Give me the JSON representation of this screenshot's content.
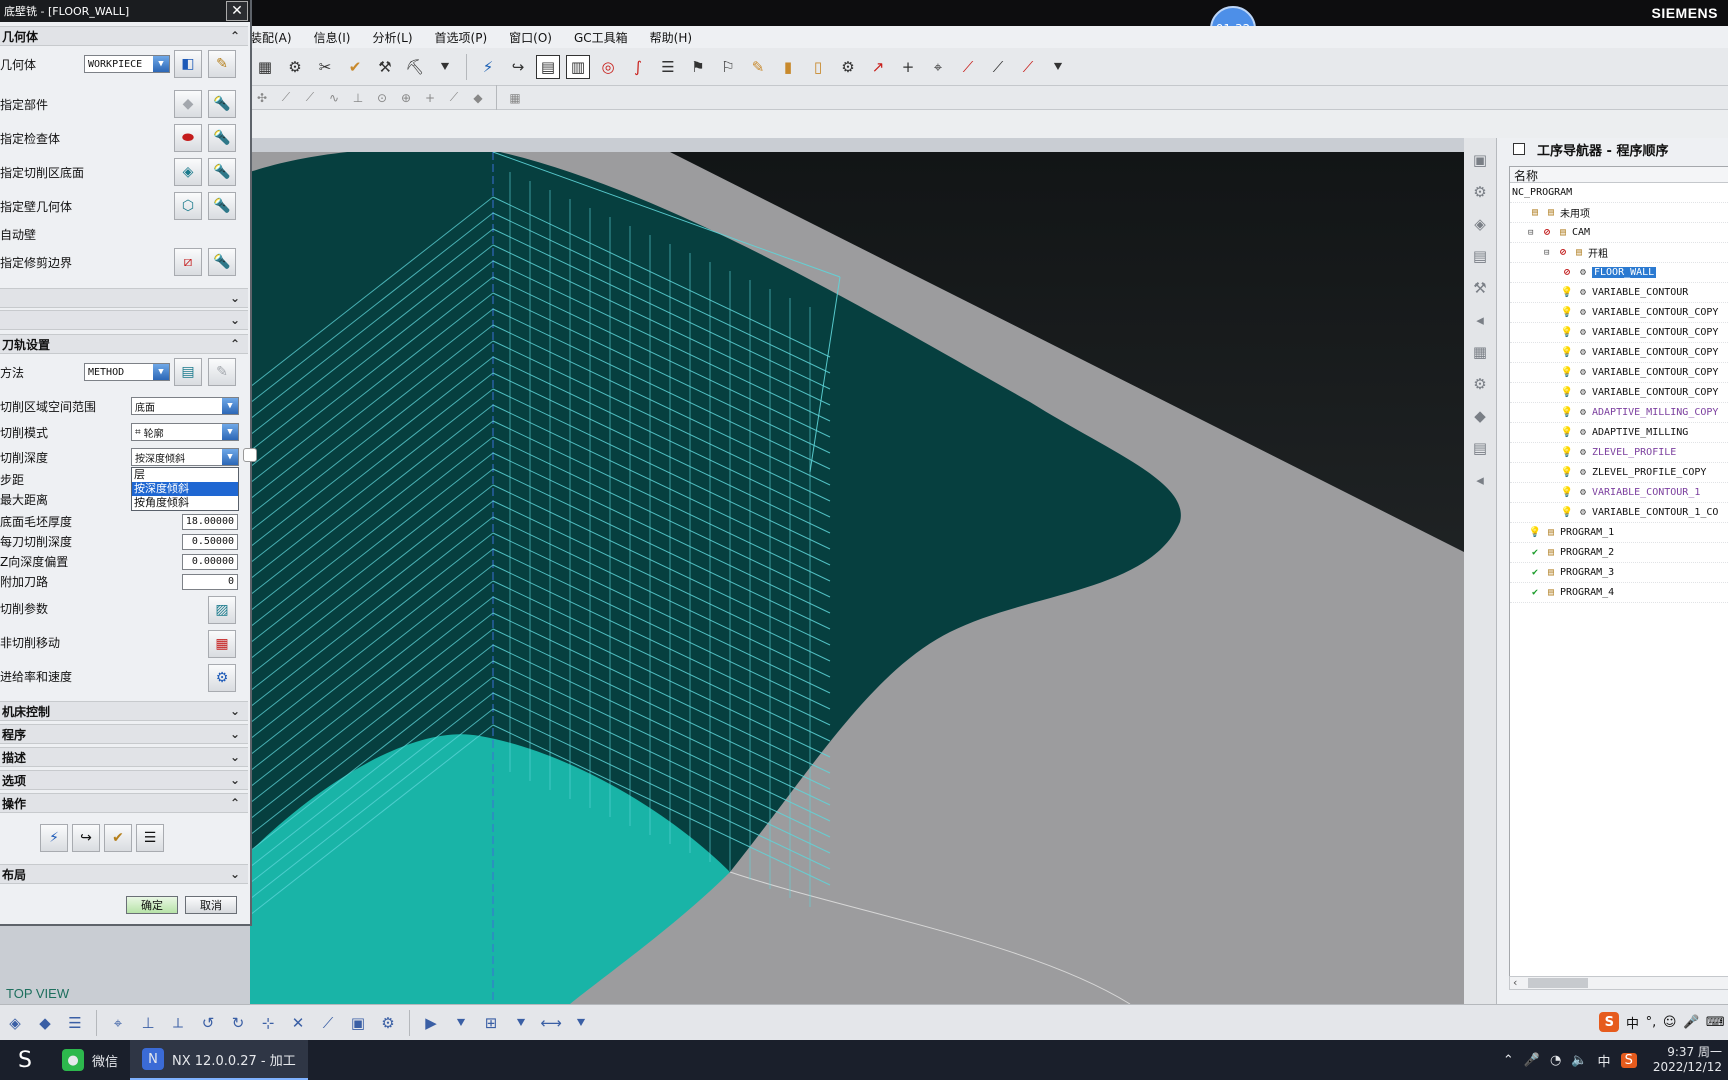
{
  "window": {
    "brand": "SIEMENS",
    "timer": "01:32"
  },
  "menu": [
    "装配(A)",
    "信息(I)",
    "分析(L)",
    "首选项(P)",
    "窗口(O)",
    "GC工具箱",
    "帮助(H)"
  ],
  "dialog": {
    "title": "底壁铣 - [FLOOR_WALL]",
    "close": "✕",
    "geometry_section": "几何体",
    "geometry_rows": [
      {
        "label": "几何体",
        "value": "WORKPIECE"
      },
      {
        "label": "指定部件"
      },
      {
        "label": "指定检查体"
      },
      {
        "label": "指定切削区底面"
      },
      {
        "label": "指定壁几何体"
      },
      {
        "label": "自动壁"
      },
      {
        "label": "指定修剪边界"
      }
    ],
    "collapsed_sections_a": [
      "",
      ""
    ],
    "method_section": "刀轨设置",
    "method_label": "方法",
    "method_value": "METHOD",
    "settings": [
      {
        "label": "切削区域空间范围",
        "value": "底面"
      },
      {
        "label": "切削模式",
        "value": "轮廓"
      },
      {
        "label": "切削深度",
        "value": "按深度倾斜"
      }
    ],
    "dropdown_options": [
      "层",
      "按深度倾斜",
      "按角度倾斜"
    ],
    "hidden_rows": [
      "步距",
      "最大距离"
    ],
    "numeric_fields": [
      {
        "label": "底面毛坯厚度",
        "value": "18.00000"
      },
      {
        "label": "每刀切削深度",
        "value": "0.50000"
      },
      {
        "label": "Z向深度偏置",
        "value": "0.00000"
      },
      {
        "label": "附加刀路",
        "value": "0"
      }
    ],
    "action_rows": [
      "切削参数",
      "非切削移动",
      "进给率和速度"
    ],
    "lower_sections": [
      "机床控制",
      "程序",
      "描述",
      "选项",
      "操作"
    ],
    "last_section": "布局",
    "ok": "确定",
    "cancel": "取消"
  },
  "viewport": {
    "view_label": "TOP VIEW",
    "colors": {
      "dark_surface": "#063f3f",
      "light_surface": "#17b5a8",
      "gray_surface": "#9a9a9c",
      "background": "#1d2122",
      "toolpath": "#5fd6da"
    }
  },
  "navigator": {
    "title": "工序导航器 - 程序顺序",
    "column": "名称",
    "items": [
      {
        "label": "NC_PROGRAM",
        "level": 0,
        "status": ""
      },
      {
        "label": "未用项",
        "level": 1,
        "status": "folder"
      },
      {
        "label": "CAM",
        "level": 1,
        "status": "noent"
      },
      {
        "label": "开粗",
        "level": 2,
        "status": "noent"
      },
      {
        "label": "FLOOR_WALL",
        "level": 3,
        "status": "noent",
        "selected": true
      },
      {
        "label": "VARIABLE_CONTOUR",
        "level": 3,
        "status": "bulb"
      },
      {
        "label": "VARIABLE_CONTOUR_COPY",
        "level": 3,
        "status": "bulb"
      },
      {
        "label": "VARIABLE_CONTOUR_COPY",
        "level": 3,
        "status": "bulb"
      },
      {
        "label": "VARIABLE_CONTOUR_COPY",
        "level": 3,
        "status": "bulb"
      },
      {
        "label": "VARIABLE_CONTOUR_COPY",
        "level": 3,
        "status": "bulb"
      },
      {
        "label": "VARIABLE_CONTOUR_COPY",
        "level": 3,
        "status": "bulb"
      },
      {
        "label": "ADAPTIVE_MILLING_COPY",
        "level": 3,
        "status": "bulb",
        "purple": true
      },
      {
        "label": "ADAPTIVE_MILLING",
        "level": 3,
        "status": "bulb"
      },
      {
        "label": "ZLEVEL_PROFILE",
        "level": 3,
        "status": "bulb",
        "purple": true
      },
      {
        "label": "ZLEVEL_PROFILE_COPY",
        "level": 3,
        "status": "bulb"
      },
      {
        "label": "VARIABLE_CONTOUR_1",
        "level": 3,
        "status": "bulb",
        "purple": true
      },
      {
        "label": "VARIABLE_CONTOUR_1_CO",
        "level": 3,
        "status": "bulb"
      },
      {
        "label": "PROGRAM_1",
        "level": 1,
        "status": "bulb"
      },
      {
        "label": "PROGRAM_2",
        "level": 1,
        "status": "ok"
      },
      {
        "label": "PROGRAM_3",
        "level": 1,
        "status": "ok"
      },
      {
        "label": "PROGRAM_4",
        "level": 1,
        "status": "ok"
      }
    ]
  },
  "ime": {
    "s": "S",
    "zh": "中",
    "punct": "°,"
  },
  "taskbar": {
    "wechat": "微信",
    "nx": "NX 12.0.0.27 - 加工",
    "ime": "中",
    "time": "9:37 周一",
    "date": "2022/12/12"
  }
}
